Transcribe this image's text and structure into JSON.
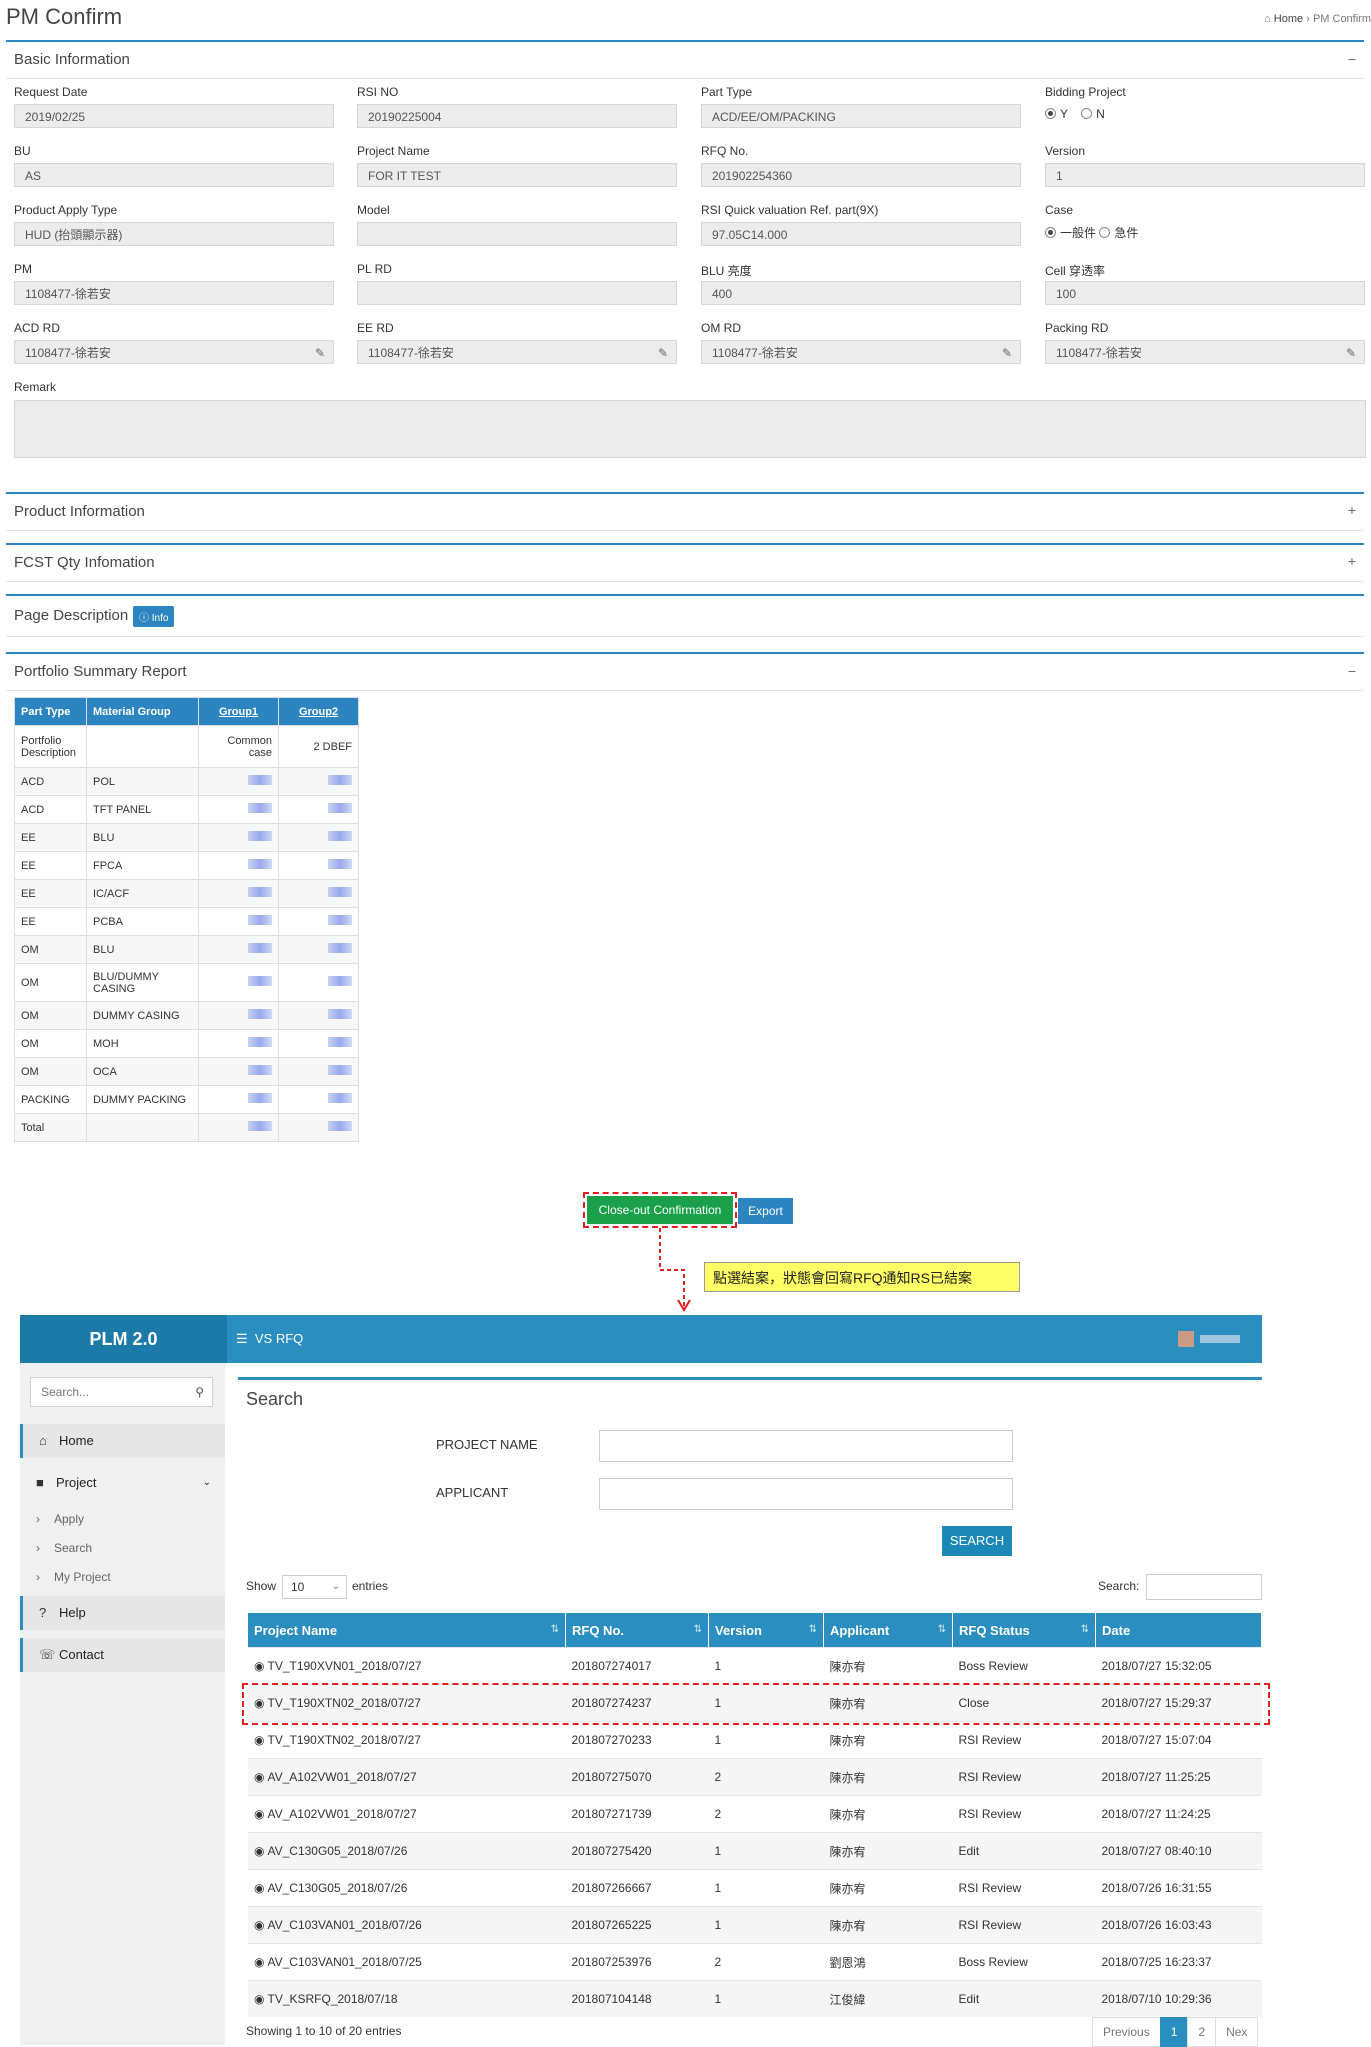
{
  "page": {
    "title": "PM Confirm",
    "breadcrumb": [
      "Home",
      "PM Confirm"
    ]
  },
  "basic": {
    "title": "Basic Information",
    "request_date": {
      "label": "Request Date",
      "value": "2019/02/25"
    },
    "rsi_no": {
      "label": "RSI NO",
      "value": "20190225004"
    },
    "part_type": {
      "label": "Part Type",
      "value": "ACD/EE/OM/PACKING"
    },
    "bidding": {
      "label": "Bidding Project",
      "y": "Y",
      "n": "N"
    },
    "bu": {
      "label": "BU",
      "value": "AS"
    },
    "project_name": {
      "label": "Project Name",
      "value": "FOR IT TEST"
    },
    "rfq_no": {
      "label": "RFQ No.",
      "value": "201902254360"
    },
    "version": {
      "label": "Version",
      "value": "1"
    },
    "product_apply_type": {
      "label": "Product Apply Type",
      "value": "HUD (抬頭顯示器)"
    },
    "model": {
      "label": "Model",
      "value": ""
    },
    "rsi_quick": {
      "label": "RSI Quick valuation Ref. part(9X)",
      "value": "97.05C14.000"
    },
    "case": {
      "label": "Case",
      "opt1": "一般件",
      "opt2": "急件"
    },
    "pm": {
      "label": "PM",
      "value": "1108477-徐若安"
    },
    "pl_rd": {
      "label": "PL RD",
      "value": ""
    },
    "blu": {
      "label": "BLU 亮度",
      "value": "400"
    },
    "cell": {
      "label": "Cell 穿透率",
      "value": "100"
    },
    "acd_rd": {
      "label": "ACD RD",
      "value": "1108477-徐若安"
    },
    "ee_rd": {
      "label": "EE RD",
      "value": "1108477-徐若安"
    },
    "om_rd": {
      "label": "OM RD",
      "value": "1108477-徐若安"
    },
    "packing_rd": {
      "label": "Packing RD",
      "value": "1108477-徐若安"
    },
    "remark": {
      "label": "Remark"
    }
  },
  "sections": {
    "product": "Product Information",
    "fcst": "FCST Qty Infomation",
    "page_desc": "Page Description",
    "info_badge": "Info",
    "portfolio": "Portfolio Summary Report"
  },
  "portfolio_table": {
    "headers": [
      "Part Type",
      "Material Group",
      "Group1",
      "Group2"
    ],
    "desc_row": [
      "Portfolio Description",
      "",
      "Common case",
      "2 DBEF"
    ],
    "rows": [
      [
        "ACD",
        "POL"
      ],
      [
        "ACD",
        "TFT PANEL"
      ],
      [
        "EE",
        "BLU"
      ],
      [
        "EE",
        "FPCA"
      ],
      [
        "EE",
        "IC/ACF"
      ],
      [
        "EE",
        "PCBA"
      ],
      [
        "OM",
        "BLU"
      ],
      [
        "OM",
        "BLU/DUMMY CASING"
      ],
      [
        "OM",
        "DUMMY CASING"
      ],
      [
        "OM",
        "MOH"
      ],
      [
        "OM",
        "OCA"
      ],
      [
        "PACKING",
        "DUMMY PACKING"
      ],
      [
        "Total",
        ""
      ]
    ]
  },
  "buttons": {
    "close_out": "Close-out Confirmation",
    "export": "Export"
  },
  "callout": "點選結案，狀態會回寫RFQ通知RS已結案",
  "plm": {
    "brand": "PLM 2.0",
    "menu": "VS RFQ",
    "sidebar": {
      "search_placeholder": "Search...",
      "items": [
        "Home",
        "Project",
        "Apply",
        "Search",
        "My Project",
        "Help",
        "Contact"
      ]
    },
    "search": {
      "title": "Search",
      "project_name_label": "PROJECT NAME",
      "applicant_label": "APPLICANT",
      "button": "SEARCH",
      "show": "Show",
      "entries_value": "10",
      "entries": "entries",
      "search_label": "Search:"
    },
    "table": {
      "headers": [
        "Project Name",
        "RFQ No.",
        "Version",
        "Applicant",
        "RFQ Status",
        "Date"
      ],
      "rows": [
        [
          "TV_T190XVN01_2018/07/27",
          "201807274017",
          "1",
          "陳亦宥",
          "Boss Review",
          "2018/07/27 15:32:05"
        ],
        [
          "TV_T190XTN02_2018/07/27",
          "201807274237",
          "1",
          "陳亦宥",
          "Close",
          "2018/07/27 15:29:37"
        ],
        [
          "TV_T190XTN02_2018/07/27",
          "201807270233",
          "1",
          "陳亦宥",
          "RSI Review",
          "2018/07/27 15:07:04"
        ],
        [
          "AV_A102VW01_2018/07/27",
          "201807275070",
          "2",
          "陳亦宥",
          "RSI Review",
          "2018/07/27 11:25:25"
        ],
        [
          "AV_A102VW01_2018/07/27",
          "201807271739",
          "2",
          "陳亦宥",
          "RSI Review",
          "2018/07/27 11:24:25"
        ],
        [
          "AV_C130G05_2018/07/26",
          "201807275420",
          "1",
          "陳亦宥",
          "Edit",
          "2018/07/27 08:40:10"
        ],
        [
          "AV_C130G05_2018/07/26",
          "201807266667",
          "1",
          "陳亦宥",
          "RSI Review",
          "2018/07/26 16:31:55"
        ],
        [
          "AV_C103VAN01_2018/07/26",
          "201807265225",
          "1",
          "陳亦宥",
          "RSI Review",
          "2018/07/26 16:03:43"
        ],
        [
          "AV_C103VAN01_2018/07/25",
          "201807253976",
          "2",
          "劉恩鴻",
          "Boss Review",
          "2018/07/25 16:23:37"
        ],
        [
          "TV_KSRFQ_2018/07/18",
          "201807104148",
          "1",
          "江俊緯",
          "Edit",
          "2018/07/10 10:29:36"
        ]
      ]
    },
    "footer": {
      "showing": "Showing 1 to 10 of 20 entries",
      "previous": "Previous",
      "page1": "1",
      "page2": "2",
      "next": "Nex"
    }
  }
}
